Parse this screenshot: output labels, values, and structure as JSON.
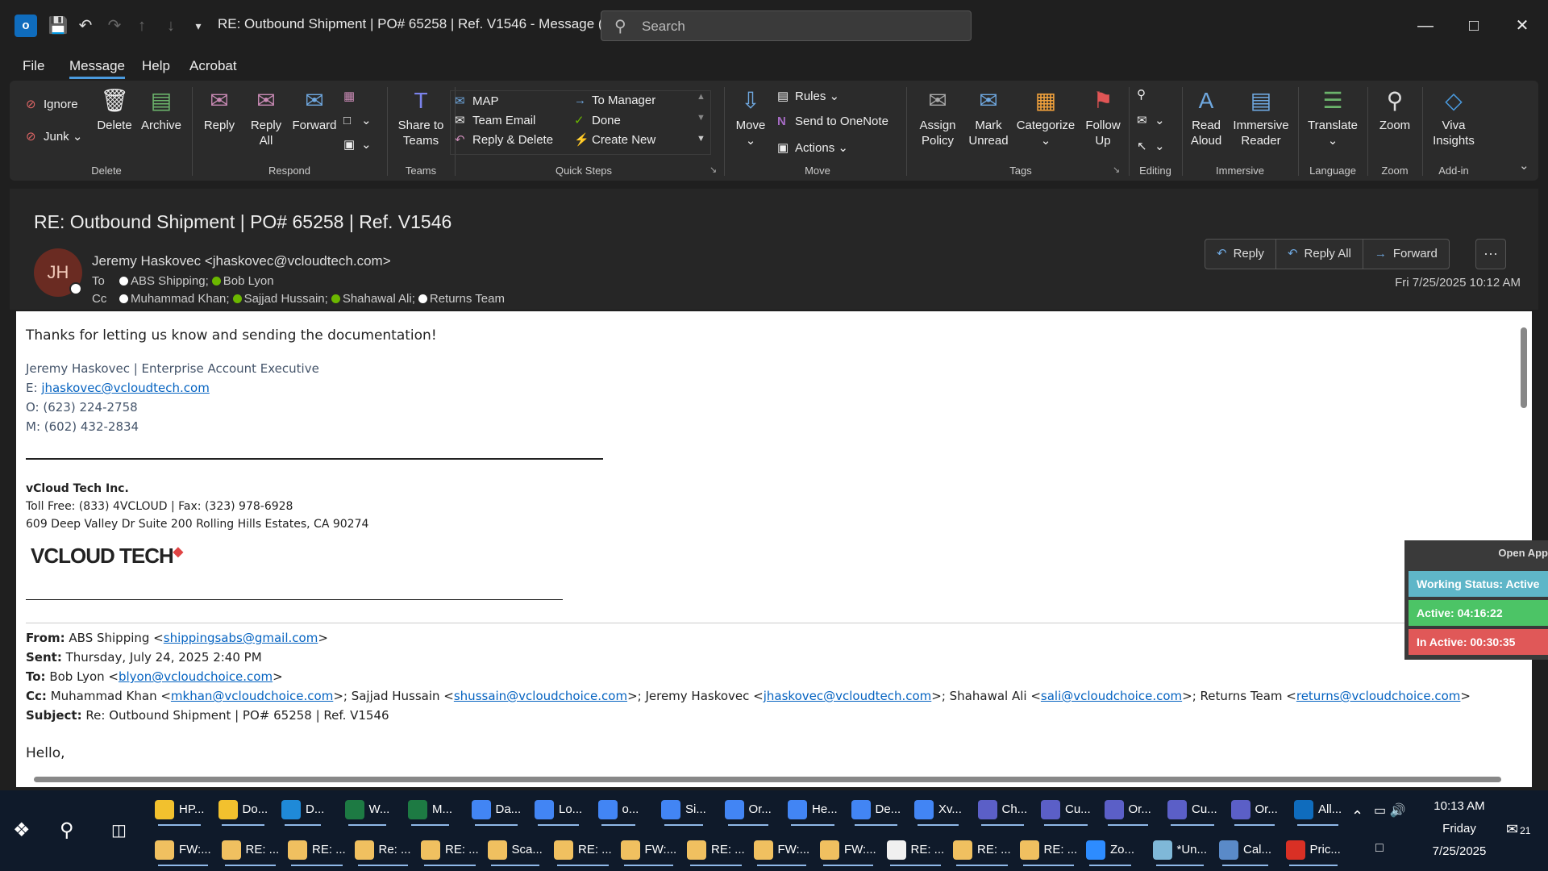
{
  "titlebar": {
    "title": "RE: Outbound Shipment | PO# 65258 | Ref. V1546  -  Message (HT...",
    "search_placeholder": "Search"
  },
  "menu": [
    "File",
    "Message",
    "Help",
    "Acrobat"
  ],
  "ribbon": {
    "delete_group": {
      "label": "Delete",
      "ignore": "Ignore",
      "junk": "Junk",
      "delete": "Delete",
      "archive": "Archive"
    },
    "respond_group": {
      "label": "Respond",
      "reply": "Reply",
      "reply_all": "Reply\nAll",
      "forward": "Forward"
    },
    "teams_group": {
      "label": "Teams",
      "share": "Share to\nTeams"
    },
    "quick_steps": {
      "label": "Quick Steps",
      "items": [
        "MAP",
        "Team Email",
        "Reply & Delete",
        "To Manager",
        "Done",
        "Create New"
      ]
    },
    "move_group": {
      "label": "Move",
      "move": "Move",
      "rules": "Rules",
      "onenote": "Send to OneNote",
      "actions": "Actions"
    },
    "tags_group": {
      "label": "Tags",
      "assign_policy": "Assign\nPolicy",
      "mark_unread": "Mark\nUnread",
      "categorize": "Categorize",
      "follow_up": "Follow\nUp"
    },
    "editing_group": {
      "label": "Editing"
    },
    "immersive_group": {
      "label": "Immersive",
      "read_aloud": "Read\nAloud",
      "immersive_reader": "Immersive\nReader"
    },
    "language_group": {
      "label": "Language",
      "translate": "Translate"
    },
    "zoom_group": {
      "label": "Zoom",
      "zoom": "Zoom"
    },
    "addin_group": {
      "label": "Add-in",
      "viva": "Viva\nInsights"
    }
  },
  "message": {
    "subject": "RE: Outbound Shipment | PO# 65258 | Ref. V1546",
    "avatar_initials": "JH",
    "sender": "Jeremy Haskovec <jhaskovec@vcloudtech.com>",
    "to_label": "To",
    "to": [
      "ABS Shipping;",
      "Bob Lyon"
    ],
    "cc_label": "Cc",
    "cc": [
      "Muhammad Khan;",
      "Sajjad Hussain;",
      "Shahawal Ali;",
      "Returns Team"
    ],
    "date": "Fri 7/25/2025 10:12 AM",
    "actions": {
      "reply": "Reply",
      "reply_all": "Reply All",
      "forward": "Forward"
    }
  },
  "body": {
    "greeting": "Thanks for letting us know and sending the documentation!",
    "sig_name": "Jeremy Haskovec | Enterprise Account Executive",
    "sig_email_label": "E: ",
    "sig_email": "jhaskovec@vcloudtech.com",
    "sig_office": "O: (623) 224-2758",
    "sig_mobile": "M: (602) 432-2834",
    "company": "vCloud Tech Inc.",
    "tollfree": "Toll Free: (833) 4VCLOUD | Fax: (323) 978-6928",
    "address": "609 Deep Valley Dr Suite 200 Rolling Hills Estates, CA 90274",
    "logo": "VCLOUD TECH",
    "from_label": "From:",
    "from_name": "ABS Shipping <",
    "from_email": "shippingsabs@gmail.com",
    "sent_label": "Sent:",
    "sent": "Thursday, July 24, 2025 2:40 PM",
    "to_label": "To:",
    "to_name": "Bob Lyon <",
    "to_email": "blyon@vcloudchoice.com",
    "cc_label": "Cc:",
    "cc_1_name": "Muhammad Khan <",
    "cc_1_email": "mkhan@vcloudchoice.com",
    "cc_2_name": ">; Sajjad Hussain <",
    "cc_2_email": "shussain@vcloudchoice.com",
    "cc_3_name": ">; Jeremy Haskovec <",
    "cc_3_email": "jhaskovec@vcloudtech.com",
    "cc_4_name": ">; Shahawal Ali <",
    "cc_4_email": "sali@vcloudchoice.com",
    "cc_5_name": ">; Returns Team <",
    "cc_5_email": "returns@vcloudchoice.com",
    "subject_label": "Subject:",
    "subject": "Re: Outbound Shipment | PO# 65258 | Ref. V1546",
    "hello": "Hello,"
  },
  "status_widget": {
    "open_app": "Open App",
    "working": "Working Status: Active",
    "active": "Active: 04:16:22",
    "inactive": "In Active: 00:30:35"
  },
  "taskbar": {
    "row1": [
      {
        "label": "HP...",
        "color": "#f2c12e"
      },
      {
        "label": "Do...",
        "color": "#f2c12e"
      },
      {
        "label": "D...",
        "color": "#1f8ad8"
      },
      {
        "label": "W...",
        "color": "#1d7a43"
      },
      {
        "label": "M...",
        "color": "#1d7a43"
      },
      {
        "label": "Da...",
        "color": "#4285f4"
      },
      {
        "label": "Lo...",
        "color": "#4285f4"
      },
      {
        "label": "o...",
        "color": "#4285f4"
      },
      {
        "label": "Si...",
        "color": "#4285f4"
      },
      {
        "label": "Or...",
        "color": "#4285f4"
      },
      {
        "label": "He...",
        "color": "#4285f4"
      },
      {
        "label": "De...",
        "color": "#4285f4"
      },
      {
        "label": "Xv...",
        "color": "#4285f4"
      },
      {
        "label": "Ch...",
        "color": "#5b5fc7"
      },
      {
        "label": "Cu...",
        "color": "#5b5fc7"
      },
      {
        "label": "Or...",
        "color": "#5b5fc7"
      },
      {
        "label": "Cu...",
        "color": "#5b5fc7"
      },
      {
        "label": "Or...",
        "color": "#5b5fc7"
      },
      {
        "label": "All...",
        "color": "#0f6cbd"
      }
    ],
    "row2": [
      {
        "label": "FW:...",
        "color": "#f0c060"
      },
      {
        "label": "RE: ...",
        "color": "#f0c060"
      },
      {
        "label": "RE: ...",
        "color": "#f0c060"
      },
      {
        "label": "Re: ...",
        "color": "#f0c060"
      },
      {
        "label": "RE: ...",
        "color": "#f0c060"
      },
      {
        "label": "Sca...",
        "color": "#f0c060"
      },
      {
        "label": "RE: ...",
        "color": "#f0c060"
      },
      {
        "label": "FW:...",
        "color": "#f0c060"
      },
      {
        "label": "RE: ...",
        "color": "#f0c060"
      },
      {
        "label": "FW:...",
        "color": "#f0c060"
      },
      {
        "label": "FW:...",
        "color": "#f0c060"
      },
      {
        "label": "RE: ...",
        "color": "#f0f0f0"
      },
      {
        "label": "RE: ...",
        "color": "#f0c060"
      },
      {
        "label": "RE: ...",
        "color": "#f0c060"
      },
      {
        "label": "Zo...",
        "color": "#2d8cff"
      },
      {
        "label": "*Un...",
        "color": "#7fb8d8"
      },
      {
        "label": "Cal...",
        "color": "#5a8ac8"
      },
      {
        "label": "Pric...",
        "color": "#d93025"
      }
    ],
    "time": "10:13 AM",
    "day": "Friday",
    "date": "7/25/2025",
    "notifications": "21"
  }
}
